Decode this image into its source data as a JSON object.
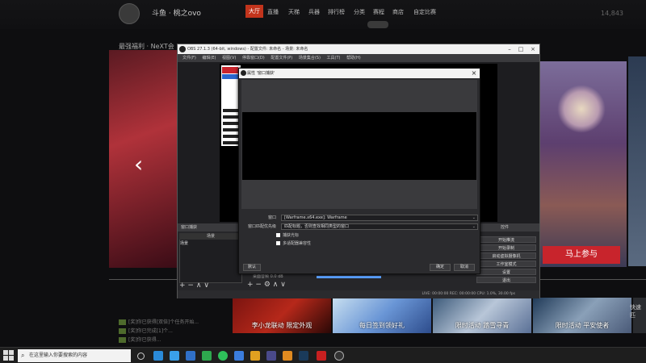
{
  "site": {
    "title": "斗鱼 · 桃之ovo",
    "nav": [
      "大厅",
      "直播",
      "天梯",
      "兵器",
      "排行榜",
      "分类",
      "赛程",
      "商店",
      "自定比赛"
    ],
    "online": "14,843",
    "ribbon": "最强福利 · NeXT会",
    "join_button": "马上参与",
    "promos": [
      "李小龙联动 限定外观",
      "每日签到领好礼",
      "限时活动 踏雪寻青",
      "限时活动 平安使者",
      "快速匹"
    ],
    "chat_lines": [
      "[奖]你已获得[双倍]个任务开始...",
      "[奖]你已完成[1]个...",
      "[奖]你已获得..."
    ]
  },
  "obs": {
    "title": "OBS 27.1.3 (64-bit, windows) - 配置文件: 未命名 - 场景: 未命名",
    "menu": [
      "文件(F)",
      "编辑(E)",
      "视图(V)",
      "停靠窗口(D)",
      "配置文件(P)",
      "场景集合(S)",
      "工具(T)",
      "帮助(H)"
    ],
    "scenes_header": "场景",
    "scene_item": "场景",
    "source_tab": "窗口捕获",
    "controls": [
      "开始推流",
      "开始录制",
      "启动虚拟摄像机",
      "工作室模式",
      "设置",
      "退出"
    ],
    "controls_header": "控件",
    "status": "LIVE: 00:00:00   REC: 00:00:00   CPU: 1.0%, 30.00 fps",
    "audio_label": "桌面音频 0.0 dB"
  },
  "dialog": {
    "title": "属性 '窗口捕获'",
    "window_label": "窗口",
    "window_value": "[Warframe.x64.exe]: Warframe",
    "priority_label": "窗口匹配优先级",
    "priority_value": "匹配标题，否则查找相同类型的窗口",
    "capture_cursor": "捕获光标",
    "multi_adapter": "多适配器兼容性",
    "defaults_button": "默认",
    "ok_button": "确定",
    "cancel_button": "取消"
  },
  "taskbar": {
    "search_placeholder": "在这里输入你要搜索的内容"
  }
}
